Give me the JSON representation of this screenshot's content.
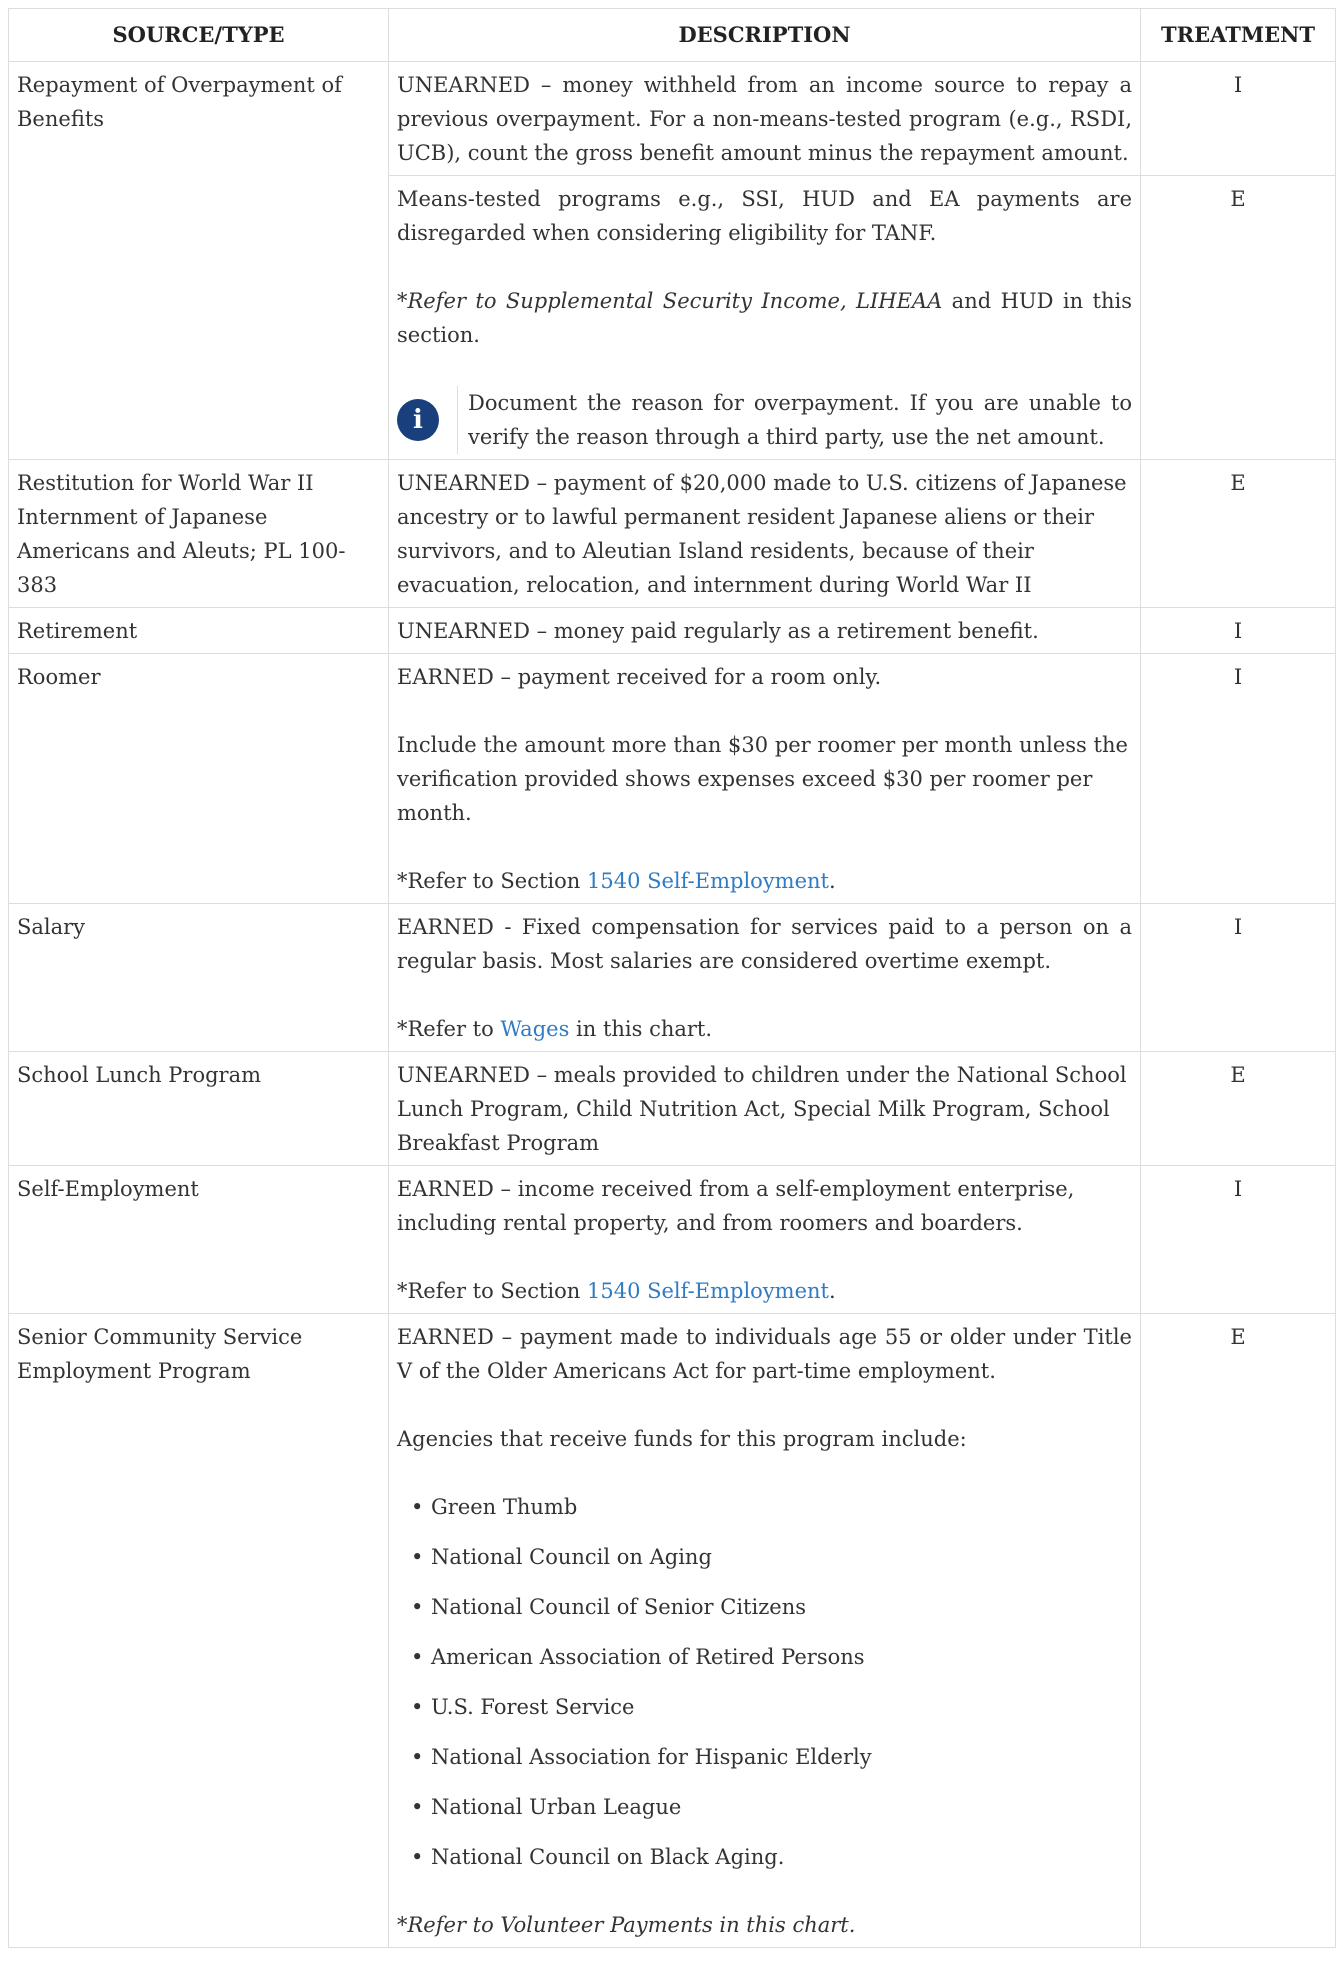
{
  "headers": {
    "source": "SOURCE/TYPE",
    "description": "DESCRIPTION",
    "treatment": "TREATMENT"
  },
  "rows": {
    "repayment": {
      "source": "Repayment of Overpayment of Benefits",
      "desc1": "UNEARNED – money withheld from an income source to repay a previous overpayment. For a non-means-tested program (e.g., RSDI, UCB), count the gross benefit amount minus the repayment amount.",
      "treat1": "I",
      "desc2": "Means-tested programs e.g., SSI, HUD and EA payments are disregarded when considering eligibility for TANF.",
      "refer_italic": "*Refer to Supplemental Security Income, LIHEAA",
      "refer_rest": " and HUD in this section.",
      "note_icon": "info-icon",
      "note": "Document the reason for overpayment. If you are unable to verify the reason through a third party, use the net amount.",
      "treat2": "E"
    },
    "restitution": {
      "source": "Restitution for World War II Internment of Japanese Americans and Aleuts; PL 100-383",
      "desc": "UNEARNED – payment of $20,000 made to U.S. citizens of Japanese ancestry or to lawful permanent resident Japanese aliens or their survivors, and to Aleutian Island residents, because of their evacuation, relocation, and internment during World War II",
      "treat": "E"
    },
    "retirement": {
      "source": "Retirement",
      "desc": "UNEARNED – money paid regularly as a retirement benefit.",
      "treat": "I"
    },
    "roomer": {
      "source": "Roomer",
      "desc1": "EARNED – payment received for a room only.",
      "desc2": "Include the amount more than $30 per roomer per month unless the verification provided shows expenses exceed $30 per roomer per month.",
      "refer_prefix": "*Refer to Section ",
      "refer_link": "1540 Self-Employment",
      "refer_suffix": ".",
      "treat": "I"
    },
    "salary": {
      "source": "Salary",
      "desc1": "EARNED - Fixed compensation for services paid to a person on a regular basis. Most salaries are considered overtime exempt.",
      "refer_prefix": "*Refer to ",
      "refer_link": "Wages",
      "refer_suffix": " in this chart.",
      "treat": "I"
    },
    "school_lunch": {
      "source": "School Lunch Program",
      "desc": "UNEARNED – meals provided to children under the National School Lunch Program, Child Nutrition Act, Special Milk Program, School Breakfast Program",
      "treat": "E"
    },
    "self_employment": {
      "source": "Self-Employment",
      "desc1": "EARNED – income received from a self-employment enterprise, including rental property, and from roomers and boarders.",
      "refer_prefix": "*Refer to Section ",
      "refer_link": "1540 Self-Employment",
      "refer_suffix": ".",
      "treat": "I"
    },
    "senior": {
      "source": "Senior Community Service Employment Program",
      "desc1": "EARNED – payment made to individuals age 55 or older under Title V of the Older Americans Act for part-time employment.",
      "desc2": "Agencies that receive funds for this program include:",
      "agencies": [
        "Green Thumb",
        "National Council on Aging",
        "National Council of Senior Citizens",
        "American Association of Retired Persons",
        "U.S. Forest Service",
        "National Association for Hispanic Elderly",
        "National Urban League",
        "National Council on Black Aging."
      ],
      "refer_prefix": "*",
      "refer_italic": "Refer to Volunteer Payments in this chart.",
      "treat": "E"
    }
  }
}
